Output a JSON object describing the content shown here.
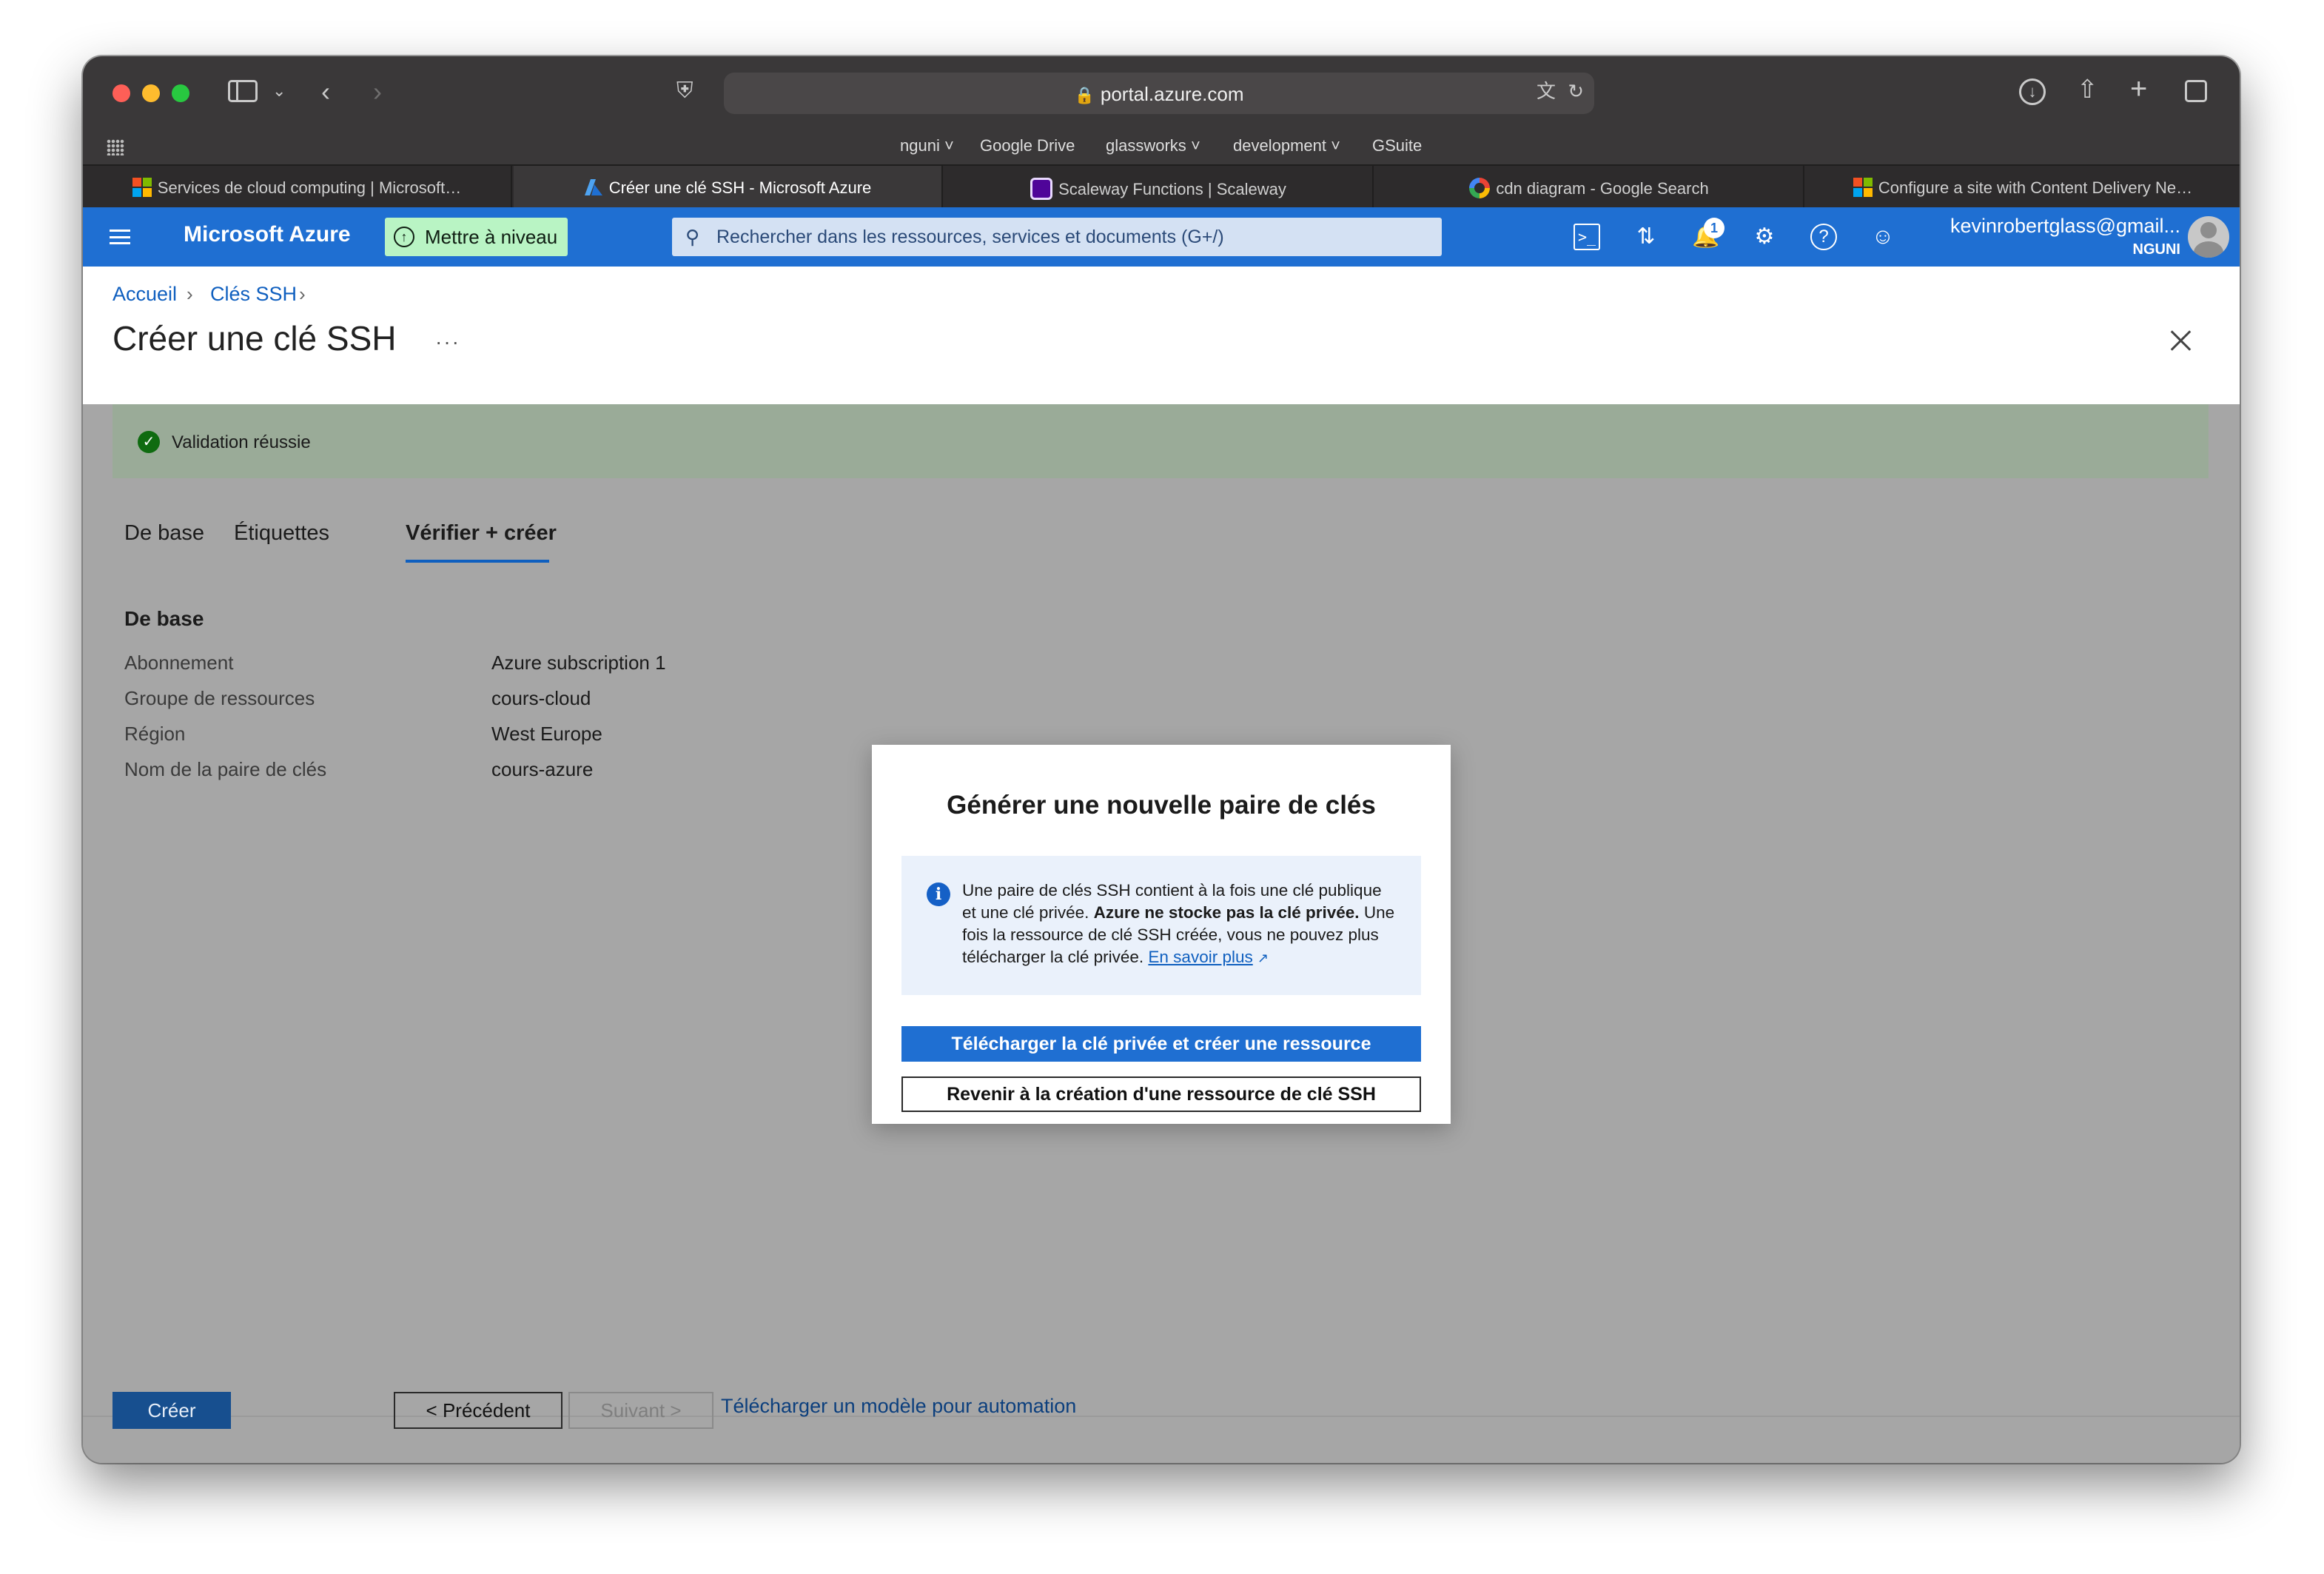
{
  "browser": {
    "url": "portal.azure.com",
    "favorites": [
      {
        "label": "nguni",
        "has_menu": true
      },
      {
        "label": "Google Drive",
        "has_menu": false
      },
      {
        "label": "glassworks",
        "has_menu": true
      },
      {
        "label": "development",
        "has_menu": true
      },
      {
        "label": "GSuite",
        "has_menu": false
      }
    ],
    "tabs": [
      {
        "label": "Services de cloud computing | Microsoft…",
        "icon": "microsoft-logo-icon",
        "active": false
      },
      {
        "label": "Créer une clé SSH - Microsoft Azure",
        "icon": "azure-logo-icon",
        "active": true
      },
      {
        "label": "Scaleway Functions | Scaleway",
        "icon": "scaleway-logo-icon",
        "active": false
      },
      {
        "label": "cdn diagram - Google Search",
        "icon": "google-logo-icon",
        "active": false
      },
      {
        "label": "Configure a site with Content Delivery Ne…",
        "icon": "microsoft-logo-icon",
        "active": false
      }
    ]
  },
  "azure": {
    "brand": "Microsoft Azure",
    "upgrade_label": "Mettre à niveau",
    "search_placeholder": "Rechercher dans les ressources, services et documents (G+/)",
    "notification_count": "1",
    "account_email": "kevinrobertglass@gmail...",
    "account_org": "NGUNI"
  },
  "page": {
    "breadcrumb": [
      "Accueil",
      "Clés SSH"
    ],
    "title": "Créer une clé SSH",
    "more": "···",
    "validation": "Validation réussie",
    "tabs": [
      "De base",
      "Étiquettes",
      "Vérifier + créer"
    ],
    "active_tab": "Vérifier + créer",
    "section_title": "De base",
    "fields": [
      {
        "label": "Abonnement",
        "value": "Azure subscription 1"
      },
      {
        "label": "Groupe de ressources",
        "value": "cours-cloud"
      },
      {
        "label": "Région",
        "value": "West Europe"
      },
      {
        "label": "Nom de la paire de clés",
        "value": "cours-azure"
      }
    ],
    "footer": {
      "create": "Créer",
      "previous": "< Précédent",
      "next": "Suivant >",
      "template_link": "Télécharger un modèle pour automation"
    }
  },
  "modal": {
    "title": "Générer une nouvelle paire de clés",
    "info_part1": "Une paire de clés SSH contient à la fois une clé publique et une clé privée.",
    "info_bold": "Azure ne stocke pas la clé privée.",
    "info_part2": "Une fois la ressource de clé SSH créée, vous ne pouvez plus télécharger la clé privée.",
    "info_link": "En savoir plus",
    "primary_button": "Télécharger la clé privée et créer une ressource",
    "secondary_button": "Revenir à la création d'une ressource de clé SSH"
  }
}
